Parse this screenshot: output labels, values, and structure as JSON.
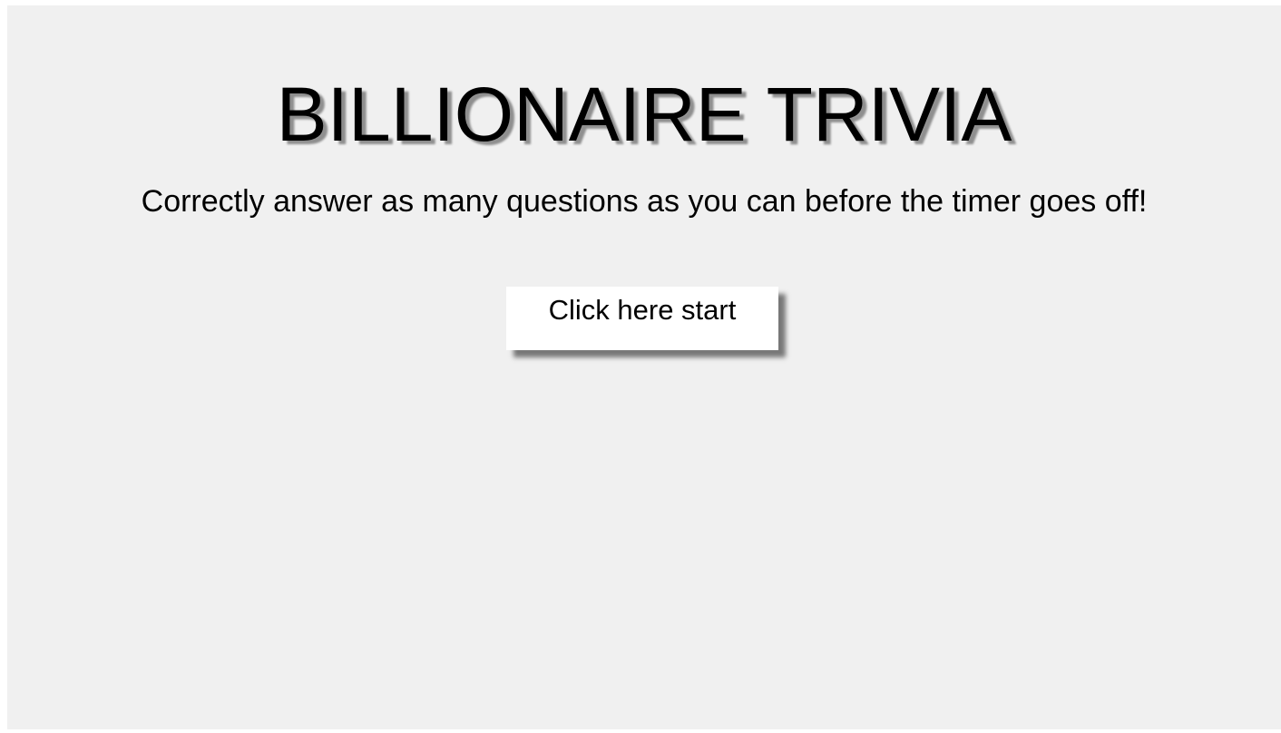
{
  "page": {
    "title": "BILLIONAIRE TRIVIA",
    "subtitle": "Correctly answer as many questions as you can before the timer goes off!",
    "start_button_label": "Click here start"
  },
  "colors": {
    "background": "#f0f0f0",
    "text": "#000000",
    "button_background": "#ffffff",
    "title_shadow": "#8f8f8f"
  }
}
